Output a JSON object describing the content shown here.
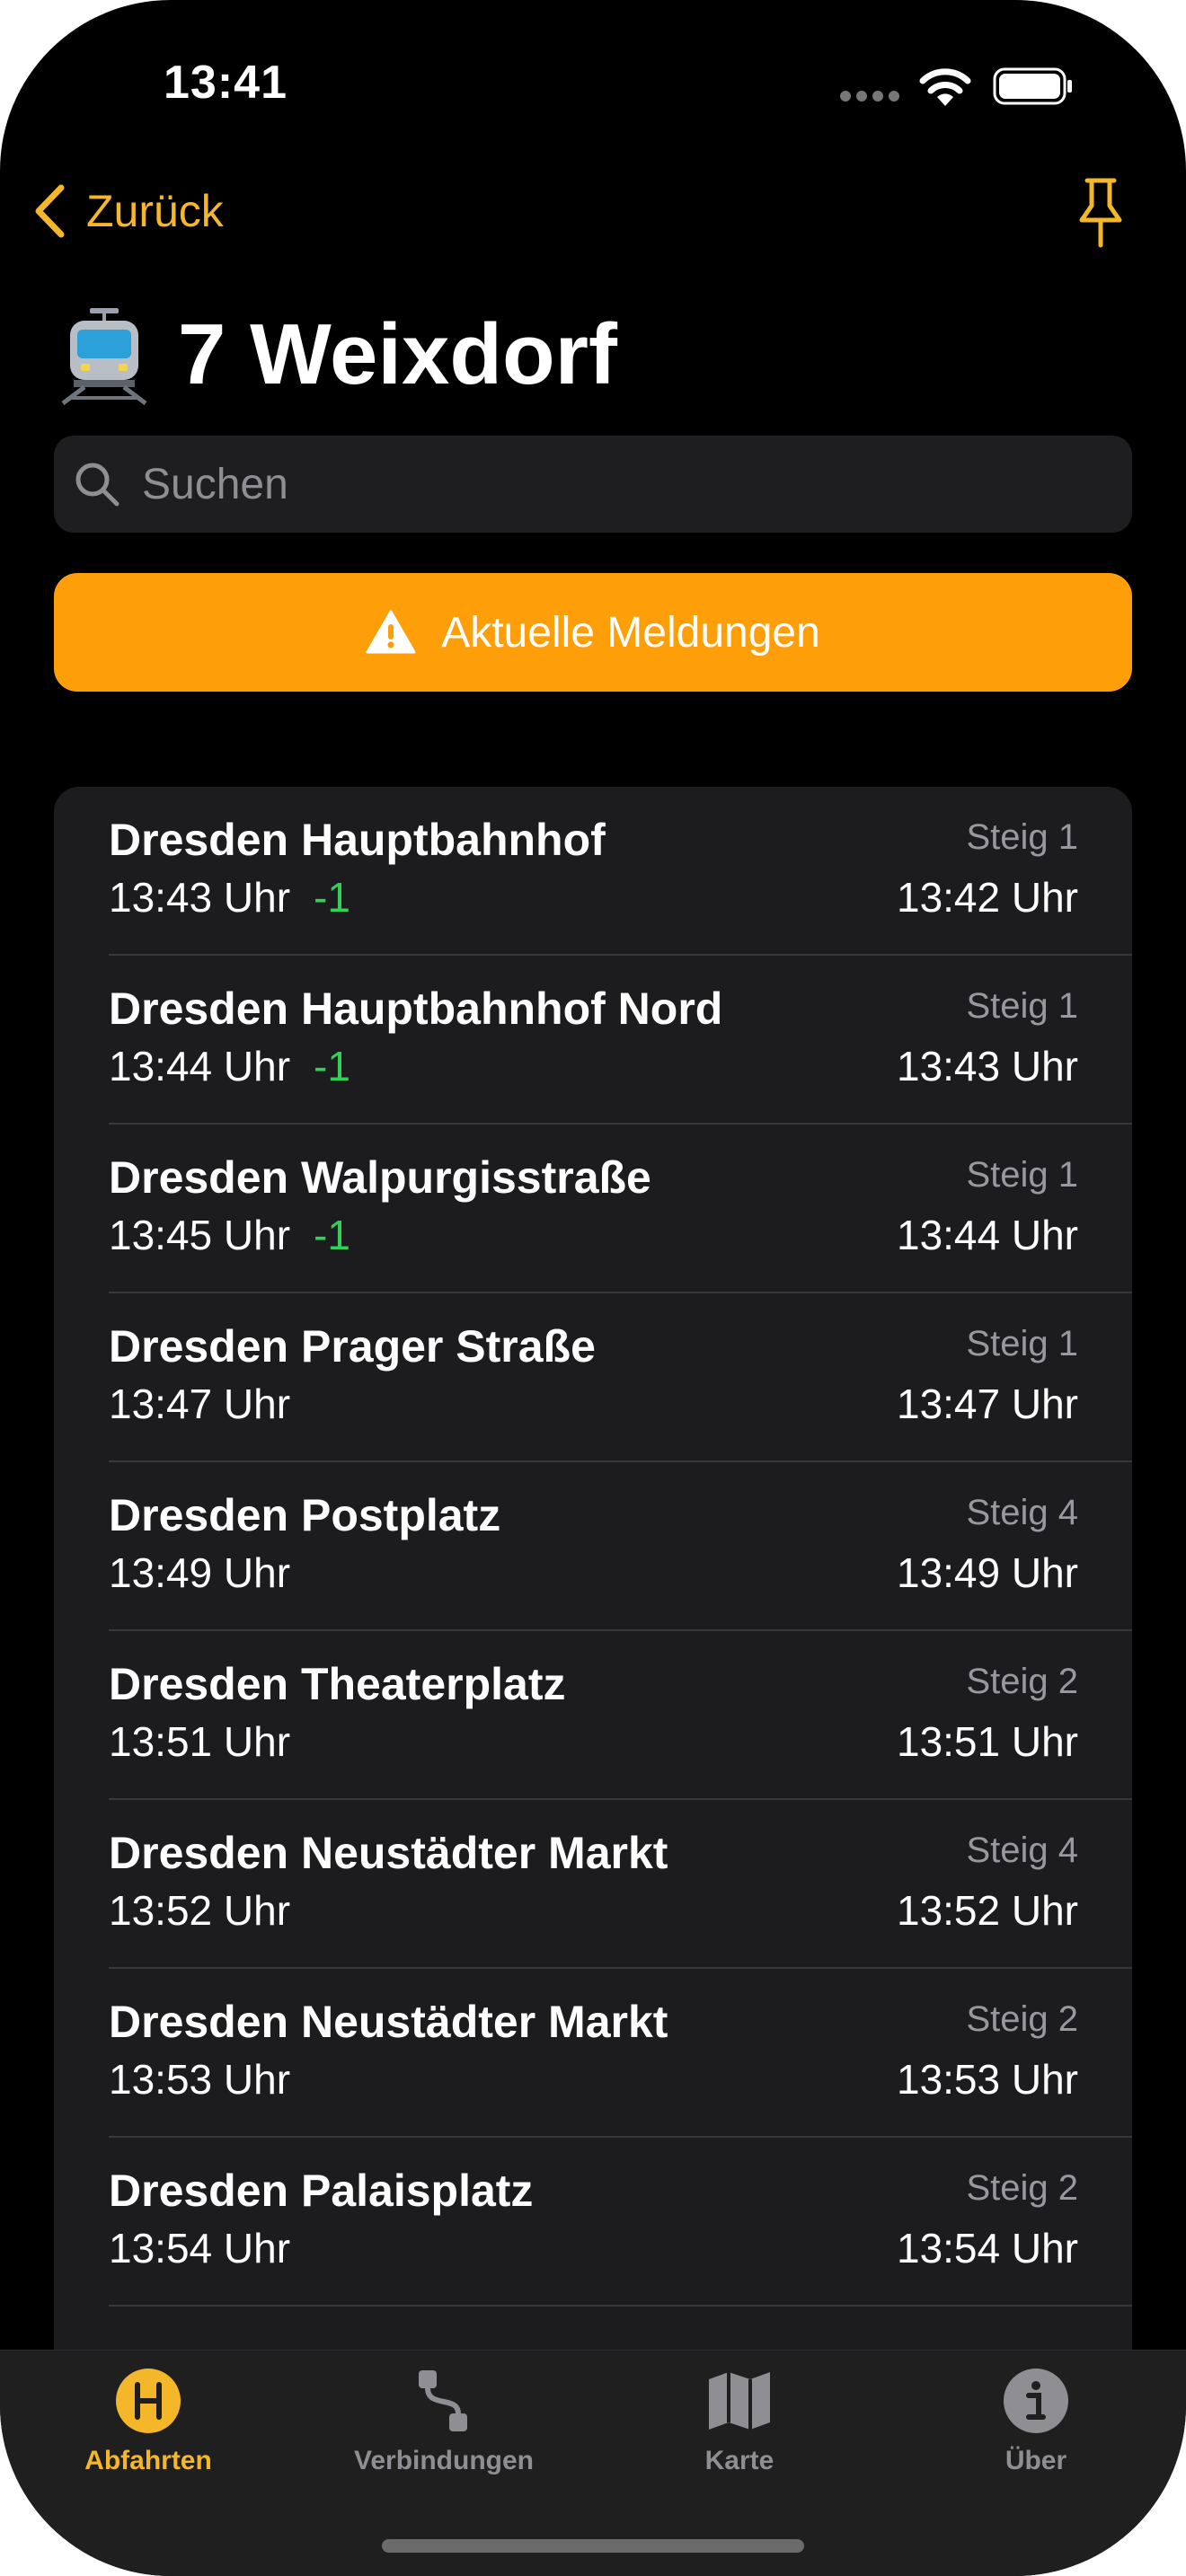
{
  "status_bar": {
    "time": "13:41"
  },
  "nav": {
    "back_label": "Zurück"
  },
  "header": {
    "title": "7 Weixdorf"
  },
  "search": {
    "placeholder": "Suchen"
  },
  "alert_button": {
    "label": "Aktuelle Meldungen"
  },
  "stops": [
    {
      "name": "Dresden Hauptbahnhof",
      "scheduled": "13:43 Uhr",
      "delay": "-1",
      "platform": "Steig 1",
      "actual": "13:42 Uhr"
    },
    {
      "name": "Dresden Hauptbahnhof Nord",
      "scheduled": "13:44 Uhr",
      "delay": "-1",
      "platform": "Steig 1",
      "actual": "13:43 Uhr"
    },
    {
      "name": "Dresden Walpurgisstraße",
      "scheduled": "13:45 Uhr",
      "delay": "-1",
      "platform": "Steig 1",
      "actual": "13:44 Uhr"
    },
    {
      "name": "Dresden Prager Straße",
      "scheduled": "13:47 Uhr",
      "delay": "",
      "platform": "Steig 1",
      "actual": "13:47 Uhr"
    },
    {
      "name": "Dresden Postplatz",
      "scheduled": "13:49 Uhr",
      "delay": "",
      "platform": "Steig 4",
      "actual": "13:49 Uhr"
    },
    {
      "name": "Dresden Theaterplatz",
      "scheduled": "13:51 Uhr",
      "delay": "",
      "platform": "Steig 2",
      "actual": "13:51 Uhr"
    },
    {
      "name": "Dresden Neustädter Markt",
      "scheduled": "13:52 Uhr",
      "delay": "",
      "platform": "Steig 4",
      "actual": "13:52 Uhr"
    },
    {
      "name": "Dresden Neustädter Markt",
      "scheduled": "13:53 Uhr",
      "delay": "",
      "platform": "Steig 2",
      "actual": "13:53 Uhr"
    },
    {
      "name": "Dresden Palaisplatz",
      "scheduled": "13:54 Uhr",
      "delay": "",
      "platform": "Steig 2",
      "actual": "13:54 Uhr"
    }
  ],
  "tabs": [
    {
      "label": "Abfahrten",
      "icon": "haltestelle-icon",
      "badge": "H",
      "active": true
    },
    {
      "label": "Verbindungen",
      "icon": "route-icon",
      "active": false
    },
    {
      "label": "Karte",
      "icon": "map-icon",
      "active": false
    },
    {
      "label": "Über",
      "icon": "info-icon",
      "active": false
    }
  ],
  "colors": {
    "accent": "#f5b72a",
    "alert": "#fe9f0a",
    "delay_green": "#30d158",
    "card": "#1c1c1e"
  }
}
